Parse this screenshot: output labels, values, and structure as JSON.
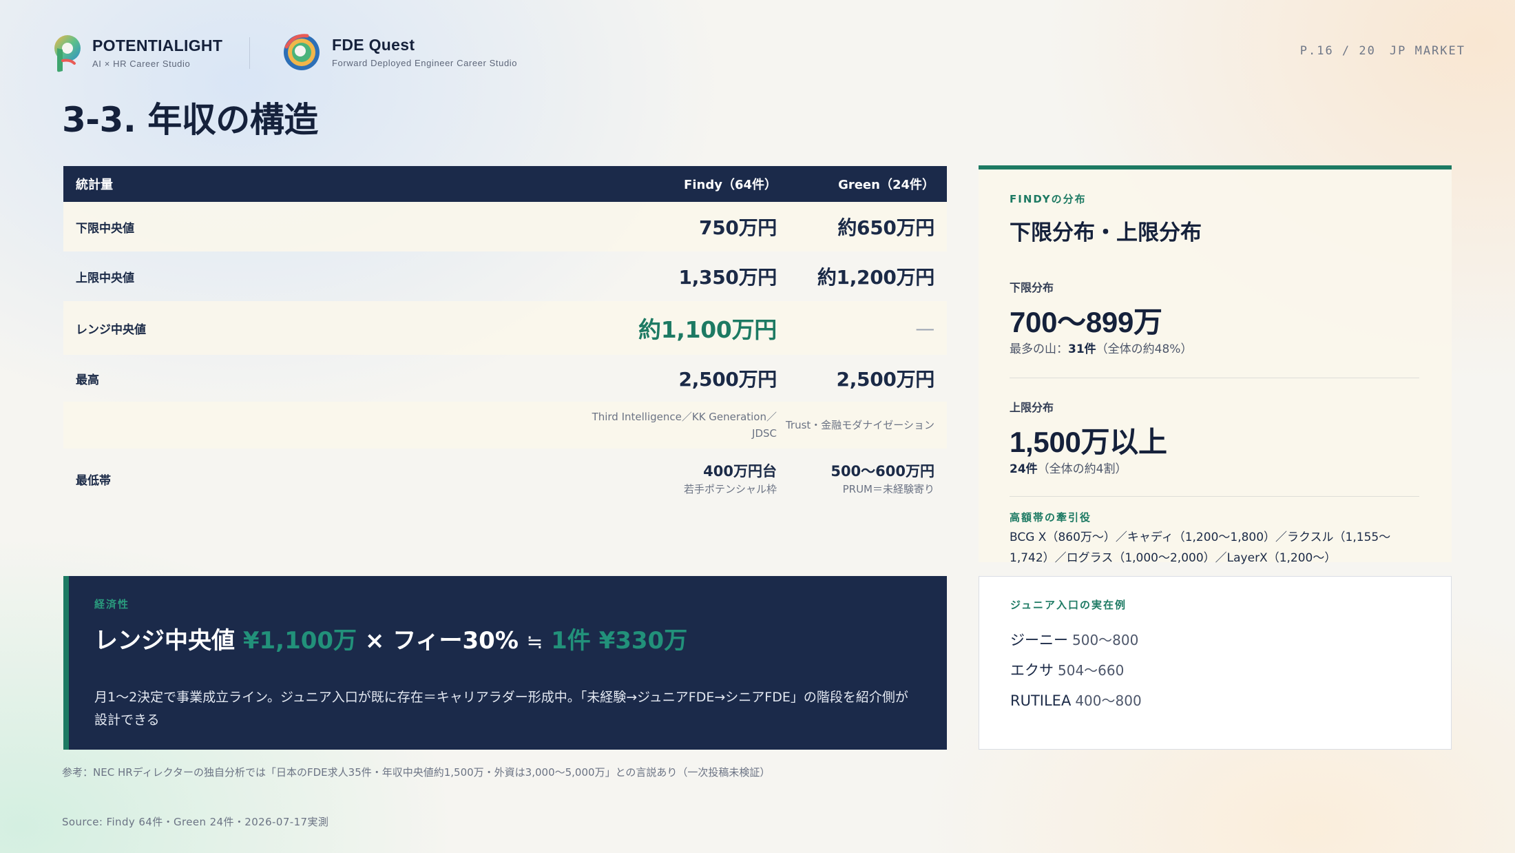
{
  "header": {
    "brand1_name": "POTENTIALIGHT",
    "brand1_sub": "AI × HR Career Studio",
    "brand2_name": "FDE Quest",
    "brand2_sub": "Forward Deployed Engineer Career Studio",
    "page": "P.16 / 20",
    "market": "JP MARKET"
  },
  "title": "3-3. 年収の構造",
  "table": {
    "headers": [
      "統計量",
      "Findy（64件）",
      "Green（24件）"
    ],
    "rows": [
      {
        "label": "下限中央値",
        "findy": "750万円",
        "green": "約650万円"
      },
      {
        "label": "上限中央値",
        "findy": "1,350万円",
        "green": "約1,200万円"
      },
      {
        "label": "レンジ中央値",
        "findy": "約1,100万円",
        "green": "—"
      },
      {
        "label": "最高",
        "findy": "2,500万円",
        "green": "2,500万円"
      },
      {
        "label": "",
        "findy_line1": "Third Intelligence／KK Generation／",
        "findy_line2": "JDSC",
        "green": "Trust・金融モダナイゼーション"
      },
      {
        "label": "最低帯",
        "findy": "400万円台",
        "findy_sub": "若手ポテンシャル枠",
        "green": "500〜600万円",
        "green_sub": "PRUM＝未経験寄り"
      }
    ]
  },
  "callout": {
    "label": "経済性",
    "part1": "レンジ中央値 ",
    "part2": "¥1,100万",
    "part3": " × フィー30% ",
    "part4": "≒",
    "part5": " 1件 ¥330万",
    "body": "月1〜2決定で事業成立ライン。ジュニア入口が既に存在＝キャリアラダー形成中。「未経験→ジュニアFDE→シニアFDE」の階段を紹介側が設計できる"
  },
  "reference_note": "参考：NEC HRディレクターの独自分析では「日本のFDE求人35件・年収中央値約1,500万・外資は3,000〜5,000万」との言説あり（一次投稿未検証）",
  "source": "Source: Findy 64件・Green 24件・2026-07-17実測",
  "right_panel": {
    "eyebrow": "FINDYの分布",
    "title": "下限分布・上限分布",
    "lower_label": "下限分布",
    "lower_value": "700〜899万",
    "lower_note_prefix": "最多の山：",
    "lower_note_bold": "31件",
    "lower_note_suffix": "（全体の約48%）",
    "upper_label": "上限分布",
    "upper_value": "1,500万以上",
    "upper_note_bold": "24件",
    "upper_note_suffix": "（全体の約4割）",
    "lead_label": "高額帯の牽引役",
    "lead_text": "BCG X（860万〜）／キャディ（1,200〜1,800）／ラクスル（1,155〜1,742）／ログラス（1,000〜2,000）／LayerX（1,200〜）"
  },
  "junior_panel": {
    "eyebrow": "ジュニア入口の実在例",
    "items": [
      {
        "company": "ジーニー",
        "range": "500〜800"
      },
      {
        "company": "エクサ",
        "range": "504〜660"
      },
      {
        "company": "RUTILEA",
        "range": "400〜800"
      }
    ]
  },
  "colors": {
    "navy": "#1b2a4a",
    "accent_green": "#1d7a63",
    "cream": "#faf6ec"
  }
}
